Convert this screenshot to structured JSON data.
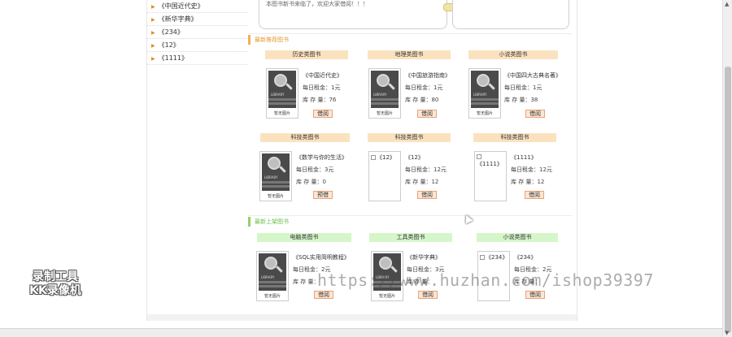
{
  "categories": [
    "《中国近代史》",
    "《新华字典》",
    "《234》",
    "《12》",
    "《1111》"
  ],
  "notice": {
    "text": "本图书新书来临了，欢迎大家借阅！！！"
  },
  "sections": [
    {
      "title": "最新推荐图书",
      "rows": [
        [
          {
            "tab": "历史类图书",
            "title": "《中国近代史》",
            "rent": "每日租金：1元",
            "stock": "库 存 量：76",
            "button": "借阅",
            "image": "placeholder",
            "noimg": "暂无图片"
          },
          {
            "tab": "地理类图书",
            "title": "《中国旅游指南》",
            "rent": "每日租金：1元",
            "stock": "库 存 量：80",
            "button": "借阅",
            "image": "placeholder",
            "noimg": "暂无图片"
          },
          {
            "tab": "小说类图书",
            "title": "《中国四大古典名著》",
            "rent": "每日租金：1元",
            "stock": "库 存 量：38",
            "button": "借阅",
            "image": "placeholder",
            "noimg": "暂无图片"
          }
        ],
        [
          {
            "tab": "科技类图书",
            "title": "《数学与你的生活》",
            "rent": "每日租金：3元",
            "stock": "库 存 量：0",
            "button": "预借",
            "image": "placeholder",
            "noimg": "暂无图片"
          },
          {
            "tab": "科技类图书",
            "title": "《12》",
            "rent": "每日租金：12元",
            "stock": "库 存 量：12",
            "button": "借阅",
            "image": "broken",
            "alt": "《12》"
          },
          {
            "tab": "科技类图书",
            "title": "《1111》",
            "rent": "每日租金：12元",
            "stock": "库 存 量：12",
            "button": "借阅",
            "image": "broken",
            "alt": "《1111》"
          }
        ]
      ]
    },
    {
      "title": "最新上架图书",
      "rows": [
        [
          {
            "tab": "电脑类图书",
            "title": "《SQL实用简明教程》",
            "rent": "每日租金：2元",
            "stock": "库 存 量：",
            "button": "借阅",
            "image": "placeholder",
            "noimg": "暂无图片"
          },
          {
            "tab": "工具类图书",
            "title": "《新华字典》",
            "rent": "每日租金：3元",
            "stock": "库 存 量：",
            "button": "借阅",
            "image": "placeholder",
            "noimg": "暂无图片"
          },
          {
            "tab": "小说类图书",
            "title": "《234》",
            "rent": "每日租金：2元",
            "stock": "库 存 量：",
            "button": "借阅",
            "image": "broken",
            "alt": "《234》"
          }
        ]
      ]
    }
  ],
  "watermark": {
    "recorder_line1": "录制工具",
    "recorder_line2": "KK录像机",
    "url": "https://www.huzhan.com/ishop39397"
  },
  "colors": {
    "orange_accent": "#f0b14f",
    "green_accent": "#8fd36a",
    "button_bg": "#fde6d3"
  }
}
